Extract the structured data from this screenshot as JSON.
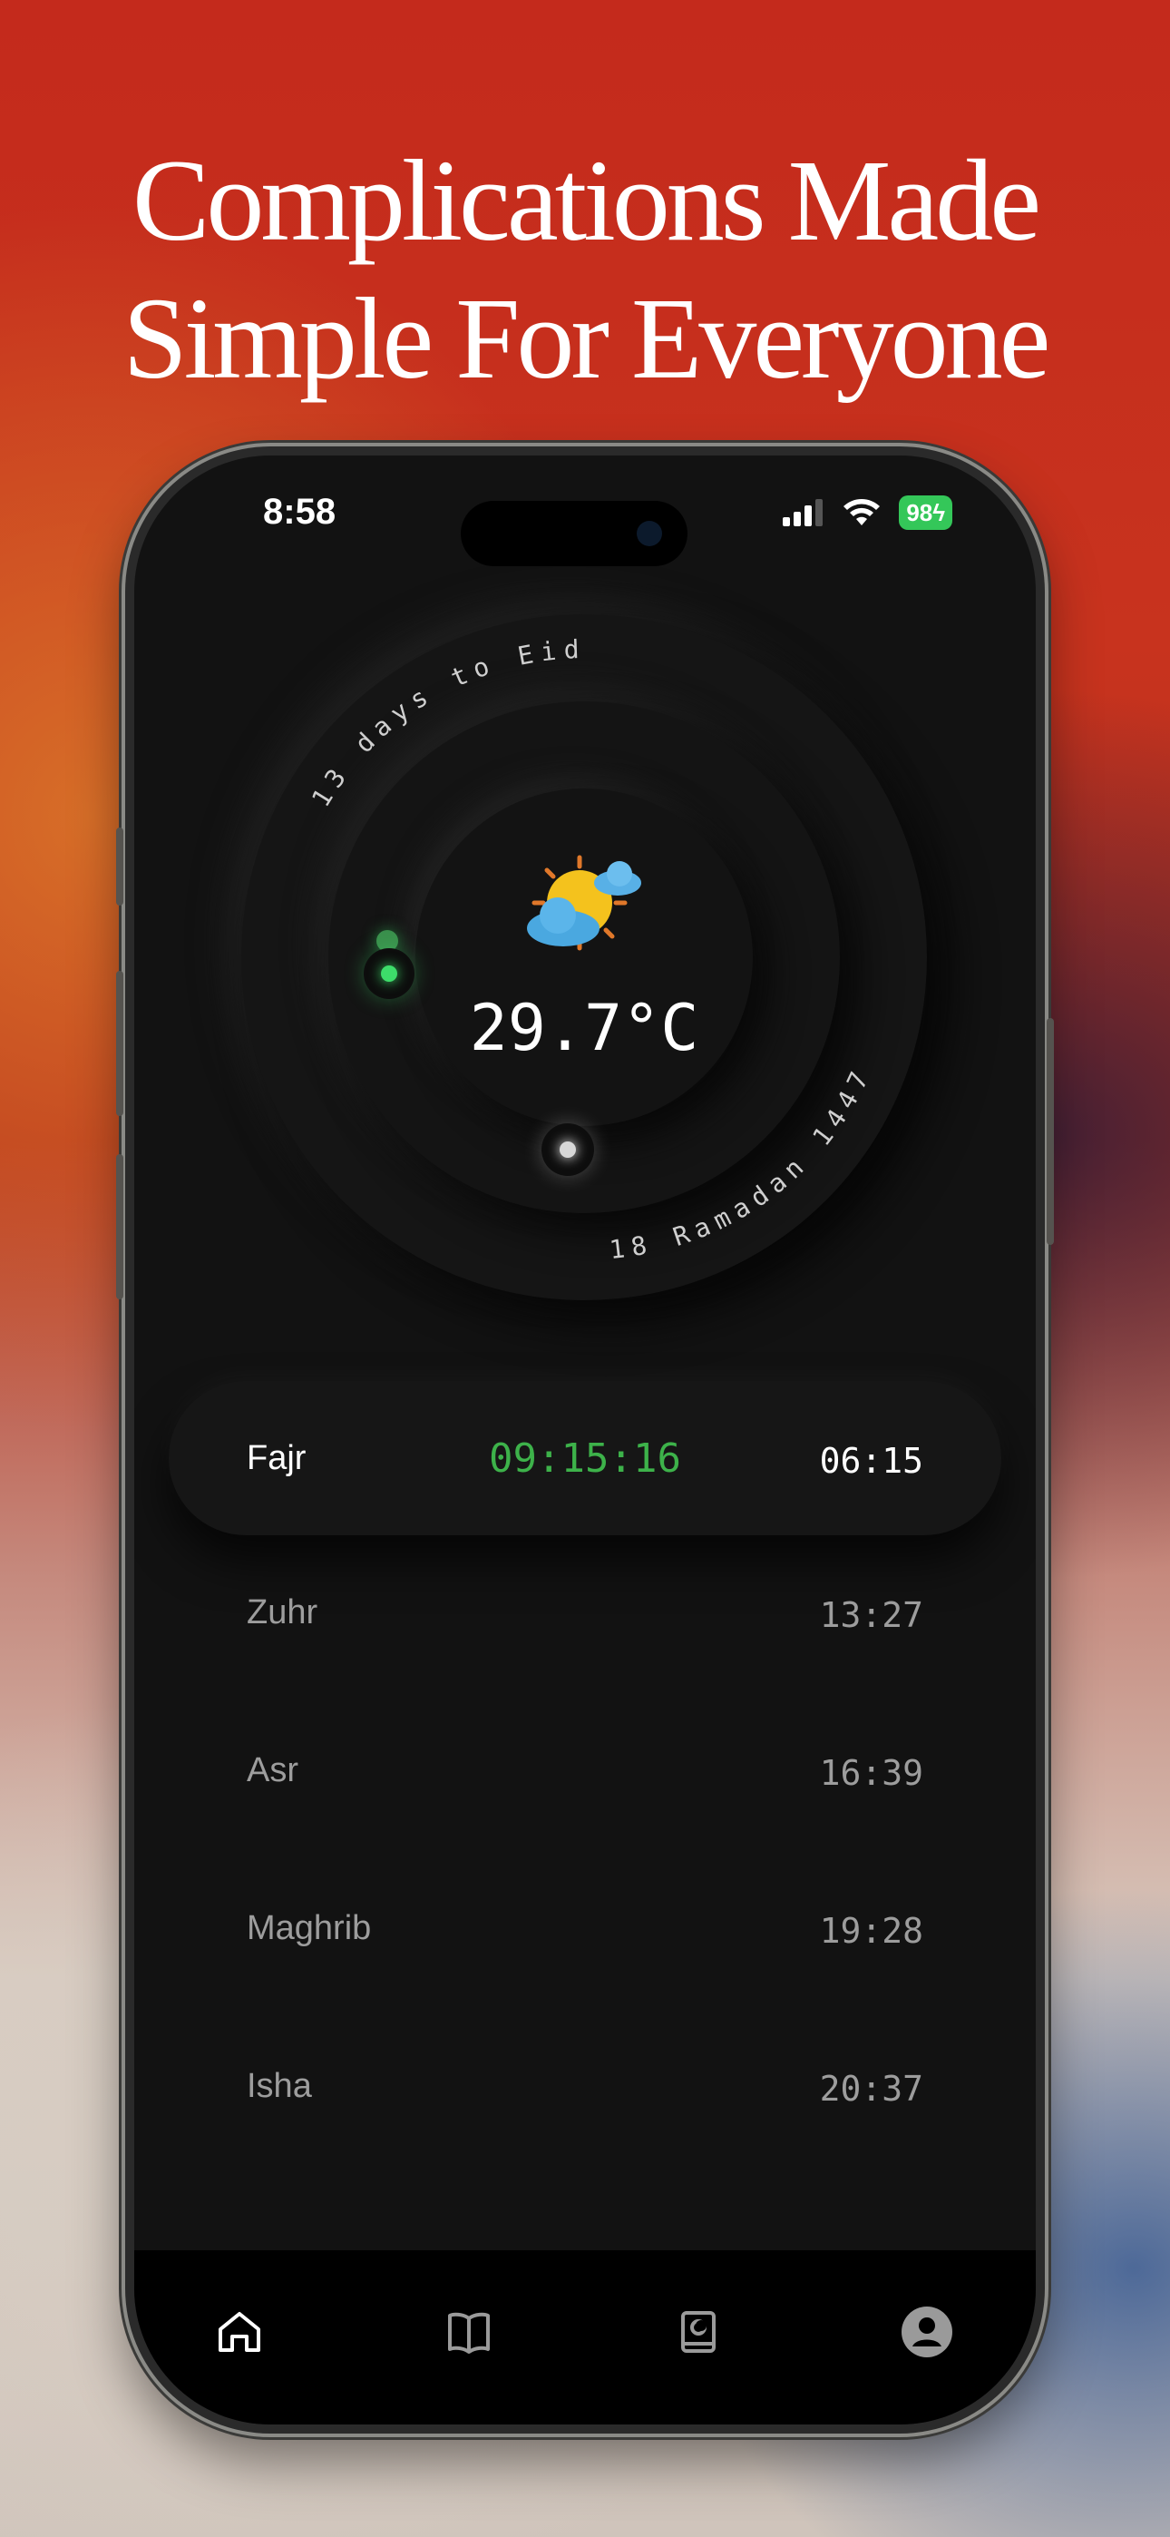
{
  "headline": {
    "line1": "Complications Made",
    "line2": "Simple For Everyone"
  },
  "status_bar": {
    "time": "8:58",
    "battery": "98",
    "icons": [
      "signal-icon",
      "wifi-icon",
      "battery-charging-icon"
    ]
  },
  "dial": {
    "outer_arc_text": "13 days to Eid",
    "lower_arc_text": "18 Ramadan 1447",
    "temperature": "29.7°C",
    "weather_icon": "partly-cloudy-sun-icon",
    "accent_color": "#3ddc6a"
  },
  "prayers": {
    "active": {
      "name": "Fajr",
      "countdown": "09:15:16",
      "time": "06:15"
    },
    "list": [
      {
        "name": "Zuhr",
        "time": "13:27"
      },
      {
        "name": "Asr",
        "time": "16:39"
      },
      {
        "name": "Maghrib",
        "time": "19:28"
      },
      {
        "name": "Isha",
        "time": "20:37"
      }
    ]
  },
  "tabbar": {
    "tabs": [
      "home-icon",
      "book-icon",
      "quran-icon",
      "profile-icon"
    ]
  }
}
